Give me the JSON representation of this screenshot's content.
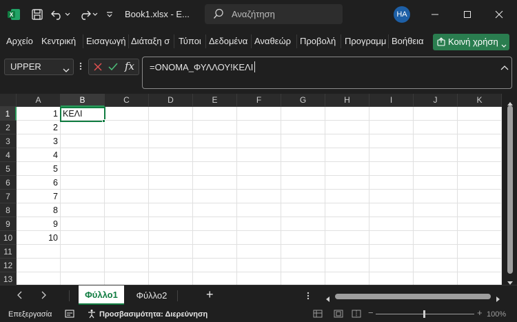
{
  "titlebar": {
    "file_title": "Book1.xlsx  -  E...",
    "search_placeholder": "Αναζήτηση",
    "avatar_initials": "HA"
  },
  "ribbon": {
    "tabs": [
      "Αρχείο",
      "Κεντρική",
      "Εισαγωγή",
      "Διάταξη σ",
      "Τύποι",
      "Δεδομένα",
      "Αναθεώρ",
      "Προβολή",
      "Προγραμμ",
      "Βοήθεια"
    ],
    "share_label": "Κοινή χρήση"
  },
  "formula_bar": {
    "name_box": "UPPER",
    "formula": "=ΟΝΟΜΑ_ΦΥΛΛΟΥ!ΚΕΛΙ",
    "fx_label": "fx"
  },
  "grid": {
    "columns": [
      "A",
      "B",
      "C",
      "D",
      "E",
      "F",
      "G",
      "H",
      "I",
      "J",
      "K"
    ],
    "rows": [
      "1",
      "2",
      "3",
      "4",
      "5",
      "6",
      "7",
      "8",
      "9",
      "10",
      "11",
      "12",
      "13"
    ],
    "column_a_values": [
      "1",
      "2",
      "3",
      "4",
      "5",
      "6",
      "7",
      "8",
      "9",
      "10"
    ],
    "b1_value": "ΚΕΛΙ",
    "selected_column": "B",
    "selected_row": "1"
  },
  "sheets": {
    "tabs": [
      "Φύλλο1",
      "Φύλλο2"
    ],
    "active": "Φύλλο1",
    "add_label": "+"
  },
  "status": {
    "mode": "Επεξεργασία",
    "accessibility": "Προσβασιμότητα: Διερεύνηση",
    "zoom": "100%"
  },
  "colors": {
    "accent_green": "#107c41",
    "share_green": "#2a7d4f",
    "avatar_blue": "#1d5fa6"
  }
}
